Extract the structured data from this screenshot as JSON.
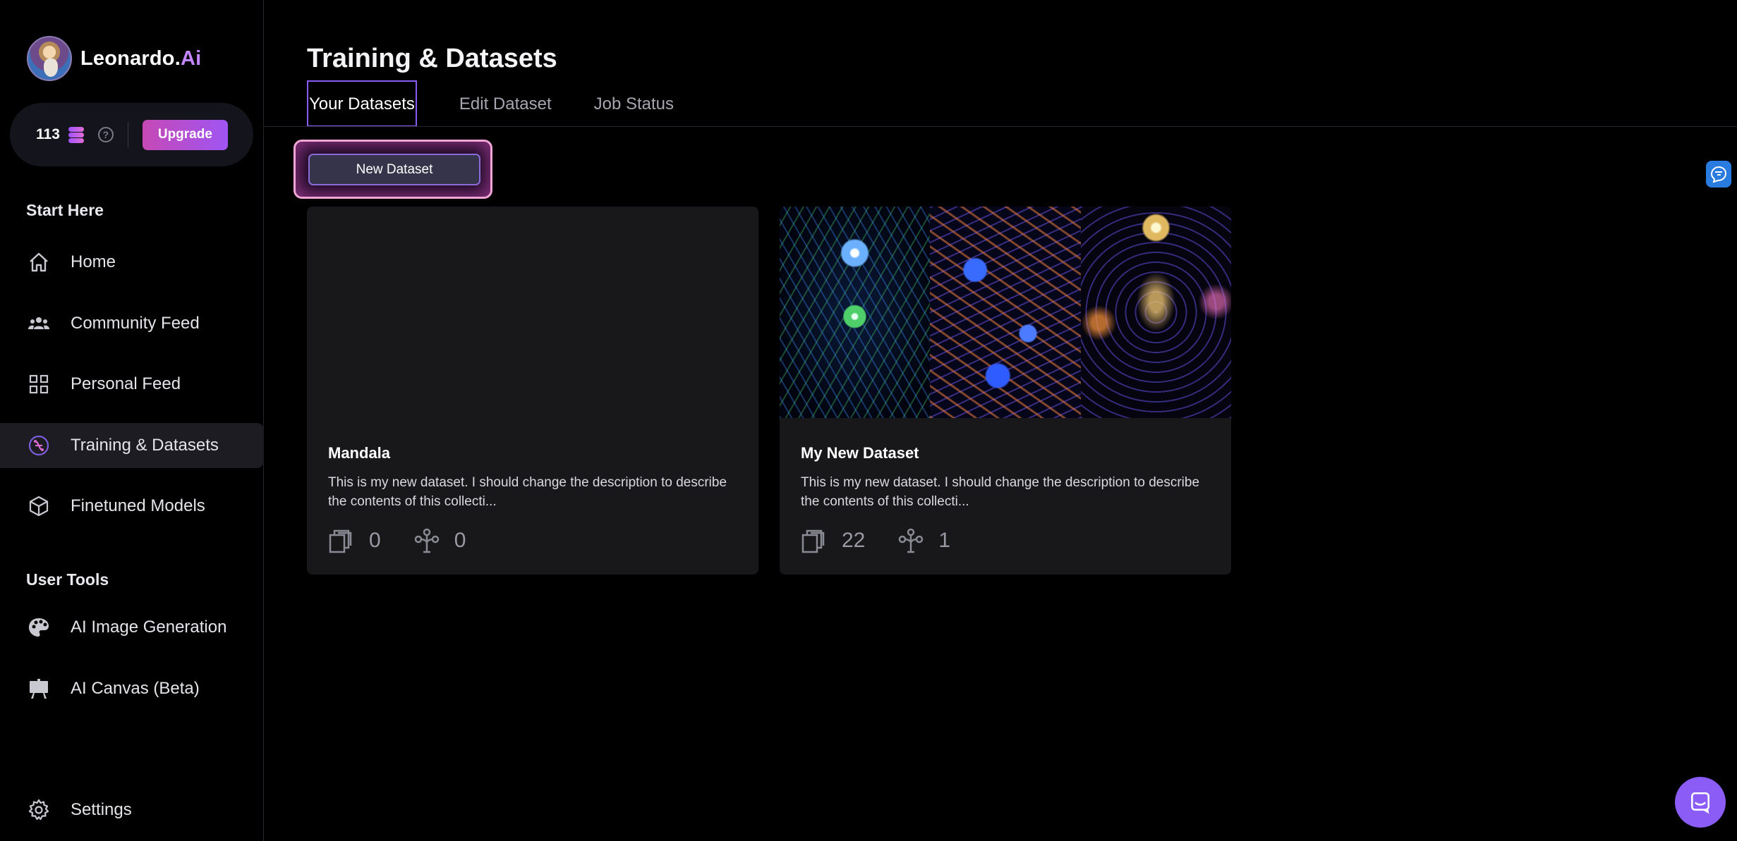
{
  "brand": {
    "name_main": "Leonardo.",
    "name_accent": "Ai"
  },
  "credits": {
    "count": "113",
    "help": "?",
    "upgrade_label": "Upgrade"
  },
  "sidebar": {
    "start_here_title": "Start Here",
    "start_items": [
      {
        "label": "Home",
        "icon": "home-icon"
      },
      {
        "label": "Community Feed",
        "icon": "users-icon"
      },
      {
        "label": "Personal Feed",
        "icon": "grid-icon"
      },
      {
        "label": "Training & Datasets",
        "icon": "training-icon",
        "active": true
      },
      {
        "label": "Finetuned Models",
        "icon": "cube-icon"
      }
    ],
    "user_tools_title": "User Tools",
    "tool_items": [
      {
        "label": "AI Image Generation",
        "icon": "palette-icon"
      },
      {
        "label": "AI Canvas (Beta)",
        "icon": "easel-icon"
      }
    ],
    "settings_label": "Settings"
  },
  "main": {
    "title": "Training & Datasets",
    "tabs": [
      {
        "label": "Your Datasets",
        "active": true
      },
      {
        "label": "Edit Dataset"
      },
      {
        "label": "Job Status"
      }
    ],
    "new_dataset_label": "New Dataset",
    "datasets": [
      {
        "title": "Mandala",
        "description": "This is my new dataset. I should change the description to describe the contents of this collecti...",
        "images": "0",
        "models": "0"
      },
      {
        "title": "My New Dataset",
        "description": "This is my new dataset. I should change the description to describe the contents of this collecti...",
        "images": "22",
        "models": "1"
      }
    ]
  },
  "colors": {
    "accent": "#8b5cf6",
    "upgrade_start": "#c649b6",
    "upgrade_end": "#9f55f2",
    "brand_ai": "#c287ff"
  }
}
